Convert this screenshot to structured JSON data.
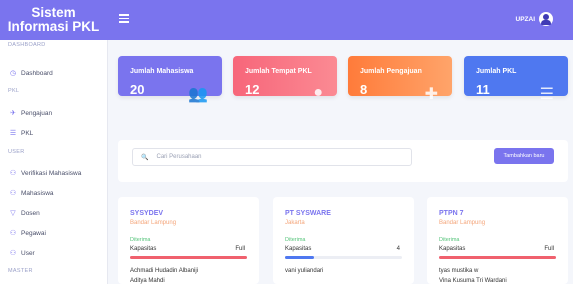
{
  "app": {
    "title": "Sistem Informasi PKL"
  },
  "sidebar": {
    "sections": {
      "dashboard": "DASHBOARD",
      "pkl": "PKL",
      "user": "USER",
      "master": "MASTER"
    },
    "items": {
      "dashboard": "Dashboard",
      "pengajuan": "Pengajuan",
      "pkl": "PKL",
      "verifikasi": "Verifikasi Mahasiswa",
      "mahasiswa": "Mahasiswa",
      "dosen": "Dosen",
      "pegawai": "Pegawai",
      "user": "User"
    }
  },
  "topbar": {
    "username": "UPZAI"
  },
  "stats": [
    {
      "label": "Jumlah Mahasiswa",
      "value": "20",
      "icon": "users-icon",
      "color": "#7a74ee"
    },
    {
      "label": "Jumlah Tempat PKL",
      "value": "12",
      "icon": "map-pin-icon",
      "color": "#f77489"
    },
    {
      "label": "Jumlah Pengajuan",
      "value": "8",
      "icon": "thumbtack-icon",
      "color": "#ff8a4a"
    },
    {
      "label": "Jumlah PKL",
      "value": "11",
      "icon": "list-check-icon",
      "color": "#4f78f0"
    }
  ],
  "search": {
    "placeholder": "Cari Perusahaan",
    "value": "",
    "add_label": "Tambahkan baru"
  },
  "companies": [
    {
      "name": "SYSYDEV",
      "location": "Bandar Lampung",
      "status": "Diterima",
      "capacity_label": "Kapasitas",
      "capacity_value": "Full",
      "capacity_fraction": 1.0,
      "bar_color": "#f0616e",
      "members": [
        "Achmadi Hudadin Albaniji",
        "Aditya Mahdi"
      ]
    },
    {
      "name": "PT SYSWARE",
      "location": "Jakarta",
      "status": "Diterima",
      "capacity_label": "Kapasitas",
      "capacity_value": "4",
      "capacity_fraction": 0.25,
      "bar_color": "#4f78f0",
      "members": [
        "vani yuliandari"
      ]
    },
    {
      "name": "PTPN 7",
      "location": "Bandar Lampung",
      "status": "Diterima",
      "capacity_label": "Kapasitas",
      "capacity_value": "Full",
      "capacity_fraction": 1.0,
      "bar_color": "#f0616e",
      "members": [
        "tyas mustika w",
        "Vina Kusuma Tri Wardani"
      ]
    }
  ]
}
